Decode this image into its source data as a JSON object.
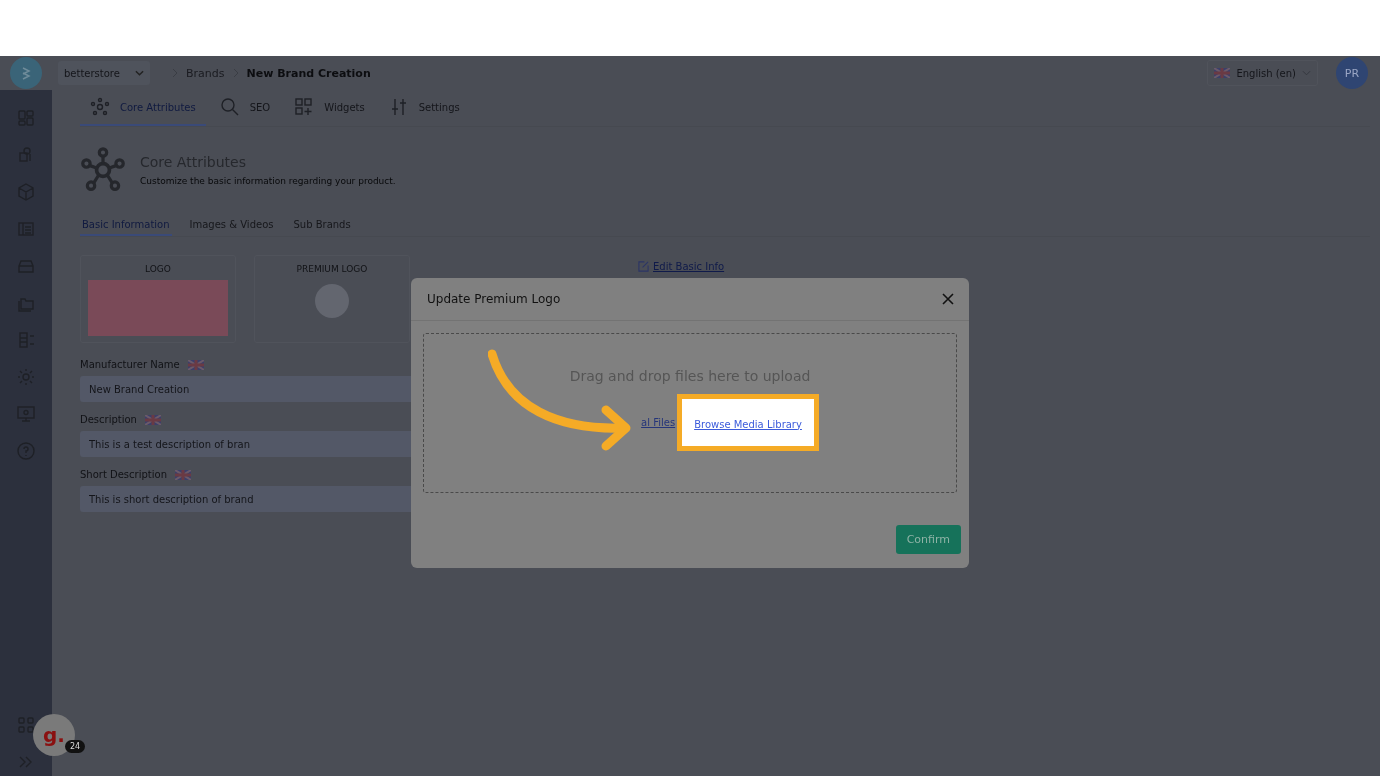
{
  "top_bar": {
    "store_select": "betterstore",
    "breadcrumbs": [
      "Brands",
      "New Brand Creation"
    ],
    "language": "English (en)",
    "user_initials": "PR"
  },
  "tabs": [
    {
      "label": "Core Attributes",
      "selected": true
    },
    {
      "label": "SEO",
      "selected": false
    },
    {
      "label": "Widgets",
      "selected": false
    },
    {
      "label": "Settings",
      "selected": false
    }
  ],
  "section": {
    "title": "Core Attributes",
    "subtitle": "Customize the basic information regarding your product."
  },
  "subtabs": [
    {
      "label": "Basic Information",
      "selected": true
    },
    {
      "label": "Images & Videos",
      "selected": false
    },
    {
      "label": "Sub Brands",
      "selected": false
    }
  ],
  "logo_cards": [
    {
      "label": "LOGO",
      "kind": "photo"
    },
    {
      "label": "PREMIUM LOGO",
      "kind": "empty"
    }
  ],
  "edit_link": "Edit Basic Info",
  "fields": [
    {
      "label": "Manufacturer Name",
      "value": "New Brand Creation"
    },
    {
      "label": "Description",
      "value": "This is a test description of bran"
    },
    {
      "label": "Short Description",
      "value": "This is short description of brand"
    }
  ],
  "modal": {
    "title": "Update Premium Logo",
    "drop_text": "Drag and drop files here to upload",
    "local_link": "al Files",
    "media_link": "Browse Media Library",
    "confirm": "Confirm"
  },
  "helper": {
    "logo": "g.",
    "badge": "24"
  }
}
